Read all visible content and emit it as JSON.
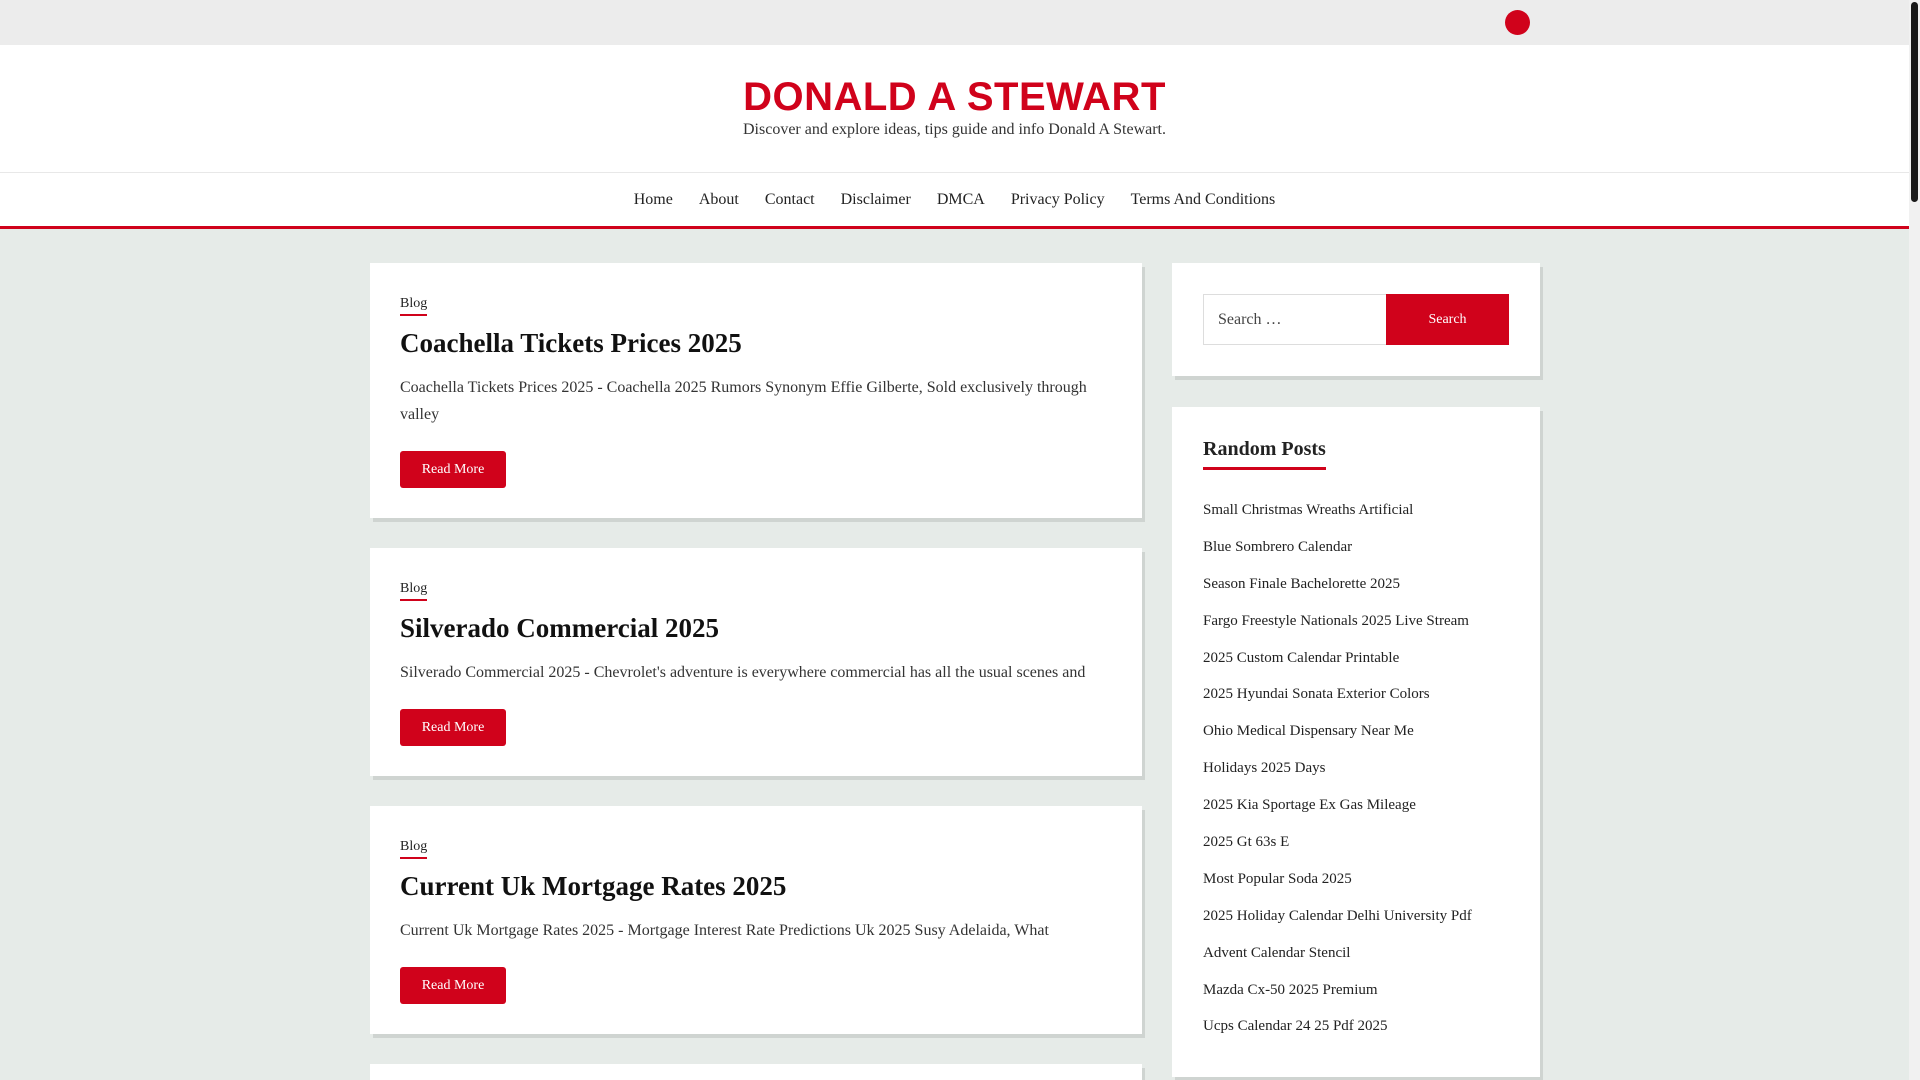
{
  "site": {
    "title": "DONALD A STEWART",
    "tagline": "Discover and explore ideas, tips guide and info Donald A Stewart."
  },
  "nav": [
    "Home",
    "About",
    "Contact",
    "Disclaimer",
    "DMCA",
    "Privacy Policy",
    "Terms And Conditions"
  ],
  "posts": [
    {
      "category": "Blog",
      "title": "Coachella Tickets Prices 2025",
      "excerpt": "Coachella Tickets Prices 2025 - Coachella 2025 Rumors Synonym Effie Gilberte, Sold exclusively through valley",
      "read_more": "Read More"
    },
    {
      "category": "Blog",
      "title": "Silverado Commercial 2025",
      "excerpt": "Silverado Commercial 2025 - Chevrolet's adventure is everywhere commercial has all the usual scenes and",
      "read_more": "Read More"
    },
    {
      "category": "Blog",
      "title": "Current Uk Mortgage Rates 2025",
      "excerpt": "Current Uk Mortgage Rates 2025 - Mortgage Interest Rate Predictions Uk 2025 Susy Adelaida, What",
      "read_more": "Read More"
    }
  ],
  "search": {
    "placeholder": "Search …",
    "button": "Search"
  },
  "random_posts": {
    "title": "Random Posts",
    "items": [
      "Small Christmas Wreaths Artificial",
      "Blue Sombrero Calendar",
      "Season Finale Bachelorette 2025",
      "Fargo Freestyle Nationals 2025 Live Stream",
      "2025 Custom Calendar Printable",
      "2025 Hyundai Sonata Exterior Colors",
      "Ohio Medical Dispensary Near Me",
      "Holidays 2025 Days",
      "2025 Kia Sportage Ex Gas Mileage",
      "2025 Gt 63s E",
      "Most Popular Soda 2025",
      "2025 Holiday Calendar Delhi University Pdf",
      "Advent Calendar Stencil",
      "Mazda Cx-50 2025 Premium",
      "Ucps Calendar 24 25 Pdf 2025"
    ]
  },
  "colors": {
    "accent": "#d0021b",
    "background": "#e6ebe8"
  }
}
